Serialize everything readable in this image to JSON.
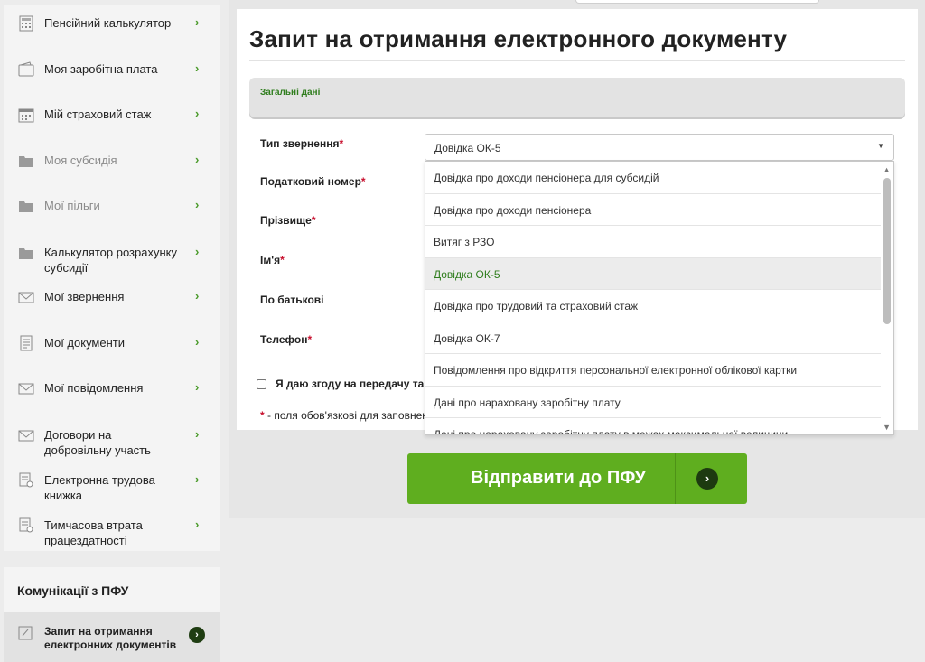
{
  "sidebar": {
    "items": [
      {
        "label": "Пенсійний калькулятор",
        "icon": "calculator-icon",
        "chevron": "›"
      },
      {
        "label": "Моя заробітна плата",
        "icon": "wallet-icon",
        "chevron": "›"
      },
      {
        "label": "Мій страховий стаж",
        "icon": "calendar-icon",
        "chevron": "›"
      },
      {
        "label": "Моя субсидія",
        "icon": "folder-icon",
        "chevron": "›"
      },
      {
        "label": "Мої пільги",
        "icon": "folder-icon",
        "chevron": "›"
      },
      {
        "label": "Калькулятор розрахунку субсидії",
        "icon": "folder-icon",
        "chevron": "›"
      },
      {
        "label": "Мої звернення",
        "icon": "envelope-icon",
        "chevron": "›"
      },
      {
        "label": "Мої документи",
        "icon": "document-icon",
        "chevron": "›"
      },
      {
        "label": "Мої повідомлення",
        "icon": "envelope-icon",
        "chevron": "›"
      },
      {
        "label": "Договори на добровільну участь",
        "icon": "envelope-icon",
        "chevron": "›"
      },
      {
        "label": "Електронна трудова книжка",
        "icon": "workbook-icon",
        "chevron": "›"
      },
      {
        "label": "Тимчасова втрата працездатності",
        "icon": "workbook-icon",
        "chevron": "›"
      }
    ]
  },
  "communications": {
    "title": "Комунікації з ПФУ",
    "item": {
      "label": "Запит на отримання електронних документів",
      "badge": "›"
    }
  },
  "main": {
    "title": "Запит на отримання електронного документу",
    "section_title": "Загальні дані",
    "fields": {
      "request_type": "Тип звернення",
      "tax_number": "Податковий номер",
      "surname": "Прізвище",
      "name": "Ім'я",
      "patronymic": "По батькові",
      "phone": "Телефон",
      "required_mark": "*"
    },
    "select": {
      "value": "Довідка ОК-5",
      "caret": "▼",
      "options": [
        "Довідка про доходи пенсіонера для субсидій",
        "Довідка про доходи пенсіонера",
        "Витяг з РЗО",
        "Довідка ОК-5",
        "Довідка про трудовий та страховий стаж",
        "Довідка ОК-7",
        "Повідомлення про відкриття персональної електронної облікової картки",
        "Дані про нараховану заробітну плату",
        "Дані про нараховану заробітну плату в межах максимальної величини"
      ],
      "selected_index": 3,
      "scroll_up": "▲",
      "scroll_down": "▼"
    },
    "consent": "Я даю згоду на передачу та обробку моїх персональних даних",
    "note_mark": "*",
    "note": " - поля обов'язкові для заповнення",
    "submit_label": "Відправити до ПФУ",
    "submit_icon": "›"
  }
}
